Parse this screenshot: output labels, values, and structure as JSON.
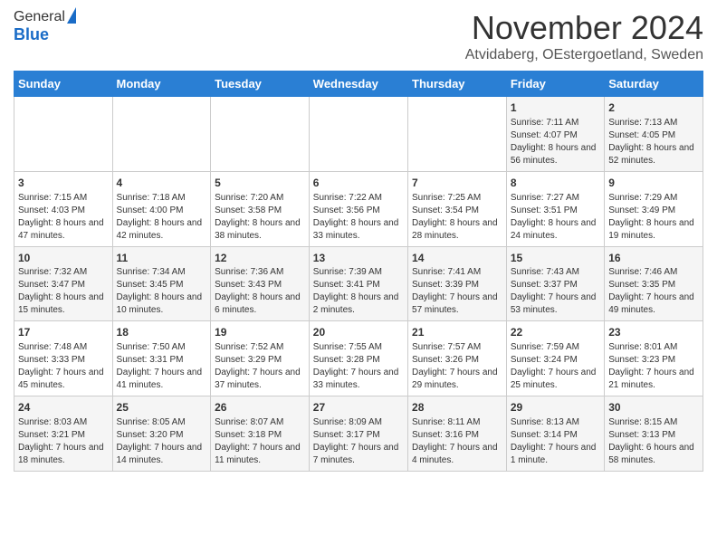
{
  "header": {
    "logo_general": "General",
    "logo_blue": "Blue",
    "month_title": "November 2024",
    "location": "Atvidaberg, OEstergoetland, Sweden"
  },
  "days_of_week": [
    "Sunday",
    "Monday",
    "Tuesday",
    "Wednesday",
    "Thursday",
    "Friday",
    "Saturday"
  ],
  "weeks": [
    [
      {
        "day": "",
        "info": ""
      },
      {
        "day": "",
        "info": ""
      },
      {
        "day": "",
        "info": ""
      },
      {
        "day": "",
        "info": ""
      },
      {
        "day": "",
        "info": ""
      },
      {
        "day": "1",
        "info": "Sunrise: 7:11 AM\nSunset: 4:07 PM\nDaylight: 8 hours and 56 minutes."
      },
      {
        "day": "2",
        "info": "Sunrise: 7:13 AM\nSunset: 4:05 PM\nDaylight: 8 hours and 52 minutes."
      }
    ],
    [
      {
        "day": "3",
        "info": "Sunrise: 7:15 AM\nSunset: 4:03 PM\nDaylight: 8 hours and 47 minutes."
      },
      {
        "day": "4",
        "info": "Sunrise: 7:18 AM\nSunset: 4:00 PM\nDaylight: 8 hours and 42 minutes."
      },
      {
        "day": "5",
        "info": "Sunrise: 7:20 AM\nSunset: 3:58 PM\nDaylight: 8 hours and 38 minutes."
      },
      {
        "day": "6",
        "info": "Sunrise: 7:22 AM\nSunset: 3:56 PM\nDaylight: 8 hours and 33 minutes."
      },
      {
        "day": "7",
        "info": "Sunrise: 7:25 AM\nSunset: 3:54 PM\nDaylight: 8 hours and 28 minutes."
      },
      {
        "day": "8",
        "info": "Sunrise: 7:27 AM\nSunset: 3:51 PM\nDaylight: 8 hours and 24 minutes."
      },
      {
        "day": "9",
        "info": "Sunrise: 7:29 AM\nSunset: 3:49 PM\nDaylight: 8 hours and 19 minutes."
      }
    ],
    [
      {
        "day": "10",
        "info": "Sunrise: 7:32 AM\nSunset: 3:47 PM\nDaylight: 8 hours and 15 minutes."
      },
      {
        "day": "11",
        "info": "Sunrise: 7:34 AM\nSunset: 3:45 PM\nDaylight: 8 hours and 10 minutes."
      },
      {
        "day": "12",
        "info": "Sunrise: 7:36 AM\nSunset: 3:43 PM\nDaylight: 8 hours and 6 minutes."
      },
      {
        "day": "13",
        "info": "Sunrise: 7:39 AM\nSunset: 3:41 PM\nDaylight: 8 hours and 2 minutes."
      },
      {
        "day": "14",
        "info": "Sunrise: 7:41 AM\nSunset: 3:39 PM\nDaylight: 7 hours and 57 minutes."
      },
      {
        "day": "15",
        "info": "Sunrise: 7:43 AM\nSunset: 3:37 PM\nDaylight: 7 hours and 53 minutes."
      },
      {
        "day": "16",
        "info": "Sunrise: 7:46 AM\nSunset: 3:35 PM\nDaylight: 7 hours and 49 minutes."
      }
    ],
    [
      {
        "day": "17",
        "info": "Sunrise: 7:48 AM\nSunset: 3:33 PM\nDaylight: 7 hours and 45 minutes."
      },
      {
        "day": "18",
        "info": "Sunrise: 7:50 AM\nSunset: 3:31 PM\nDaylight: 7 hours and 41 minutes."
      },
      {
        "day": "19",
        "info": "Sunrise: 7:52 AM\nSunset: 3:29 PM\nDaylight: 7 hours and 37 minutes."
      },
      {
        "day": "20",
        "info": "Sunrise: 7:55 AM\nSunset: 3:28 PM\nDaylight: 7 hours and 33 minutes."
      },
      {
        "day": "21",
        "info": "Sunrise: 7:57 AM\nSunset: 3:26 PM\nDaylight: 7 hours and 29 minutes."
      },
      {
        "day": "22",
        "info": "Sunrise: 7:59 AM\nSunset: 3:24 PM\nDaylight: 7 hours and 25 minutes."
      },
      {
        "day": "23",
        "info": "Sunrise: 8:01 AM\nSunset: 3:23 PM\nDaylight: 7 hours and 21 minutes."
      }
    ],
    [
      {
        "day": "24",
        "info": "Sunrise: 8:03 AM\nSunset: 3:21 PM\nDaylight: 7 hours and 18 minutes."
      },
      {
        "day": "25",
        "info": "Sunrise: 8:05 AM\nSunset: 3:20 PM\nDaylight: 7 hours and 14 minutes."
      },
      {
        "day": "26",
        "info": "Sunrise: 8:07 AM\nSunset: 3:18 PM\nDaylight: 7 hours and 11 minutes."
      },
      {
        "day": "27",
        "info": "Sunrise: 8:09 AM\nSunset: 3:17 PM\nDaylight: 7 hours and 7 minutes."
      },
      {
        "day": "28",
        "info": "Sunrise: 8:11 AM\nSunset: 3:16 PM\nDaylight: 7 hours and 4 minutes."
      },
      {
        "day": "29",
        "info": "Sunrise: 8:13 AM\nSunset: 3:14 PM\nDaylight: 7 hours and 1 minute."
      },
      {
        "day": "30",
        "info": "Sunrise: 8:15 AM\nSunset: 3:13 PM\nDaylight: 6 hours and 58 minutes."
      }
    ]
  ]
}
